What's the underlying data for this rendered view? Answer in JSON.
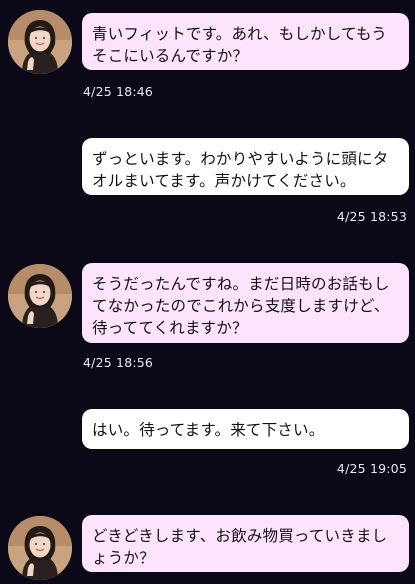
{
  "messages": [
    {
      "side": "in",
      "text": "青いフィットです。あれ、もしかしてもうそこにいるんですか？",
      "time": "4/25 18:46"
    },
    {
      "side": "out",
      "text": "ずっといます。わかりやすいように頭にタオルまいてます。声かけてください。",
      "time": "4/25 18:53"
    },
    {
      "side": "in",
      "text": "そうだったんですね。まだ日時のお話もしてなかったのでこれから支度しますけど、待っててくれますか？",
      "time": "4/25 18:56"
    },
    {
      "side": "out",
      "text": "はい。待ってます。来て下さい。",
      "time": "4/25 19:05"
    },
    {
      "side": "in",
      "text": "どきどきします、お飲み物買っていきましょうか？",
      "time": ""
    }
  ],
  "colors": {
    "background": "#0b0818",
    "incoming_bubble": "#fde3fc",
    "outgoing_bubble": "#ffffff",
    "timestamp": "#e8e8ee"
  },
  "icons": {
    "avatar": "woman-profile-photo"
  }
}
